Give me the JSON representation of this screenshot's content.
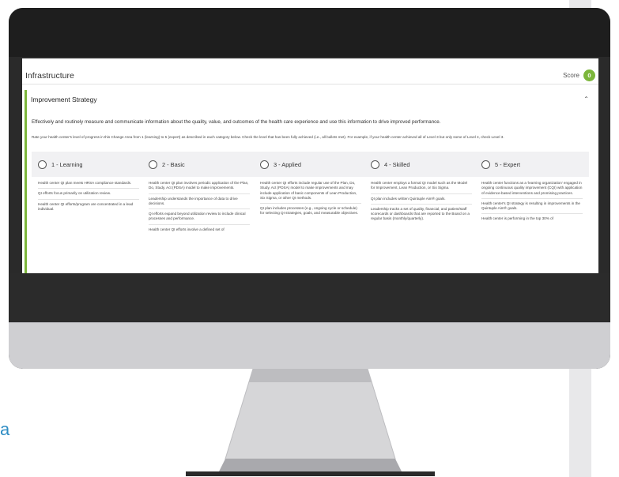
{
  "edge_text": "a",
  "screen": {
    "section_title": "Infrastructure",
    "score_label": "Score",
    "score_value": "0",
    "panel_title": "Improvement Strategy",
    "description": "Effectively and routinely measure and communicate information about the quality, value, and outcomes of the health care experience and use this information to drive improved performance.",
    "rate_text": "Rate your health center's level of progress in this Change Area from 1 (learning) to 5 (expert) as described in each category below. Check the level that has been fully achieved (i.e., all bullets met). For example, if your health center achieved all of Level 3 but only some of Level 4, check Level 3.",
    "levels": [
      {
        "label": "1 - Learning",
        "criteria": [
          "Health center QI plan meets HRSA compliance standards.",
          "QI efforts focus primarily on utilization review.",
          "Health center QI efforts/program are concentrated in a lead individual."
        ]
      },
      {
        "label": "2 - Basic",
        "criteria": [
          "Health center QI plan involves periodic application of the Plan, Do, Study, Act (PDSA) model to make improvements.",
          "Leadership understands the importance of data to drive decisions.",
          "QI efforts expand beyond utilization review to include clinical processes and performance.",
          "Health center QI efforts involve a defined set of"
        ]
      },
      {
        "label": "3 - Applied",
        "criteria": [
          "Health center QI efforts include regular use of the Plan, Do, Study, Act (PDSA) model to make improvements and may include application of basic components of Lean Production, Six Sigma, or other QI methods.",
          "QI plan includes processes (e.g., ongoing cycle or schedule) for selecting QI strategies, goals, and measurable objectives."
        ]
      },
      {
        "label": "4 - Skilled",
        "criteria": [
          "Health center employs a formal QI model such as the Model for Improvement, Lean Production, or Six Sigma.",
          "QI plan includes written Quintuple Aim® goals.",
          "Leadership tracks a set of quality, financial, and patient/staff scorecards or dashboards that are reported to the Board on a regular basis (monthly/quarterly)."
        ]
      },
      {
        "label": "5 - Expert",
        "criteria": [
          "Health center functions as a 'learning organization' engaged in ongoing continuous quality improvement (CQI) with application of evidence-based interventions and promising practices.",
          "Health center's QI strategy is resulting in improvements in the Quintuple Aim® goals.",
          "Health center is performing in the top 30% of"
        ]
      }
    ]
  },
  "colors": {
    "accent": "#7cb63b",
    "bezel": "#1e1e1e",
    "chin": "#cfcfd2",
    "stand": "#d4d4d6",
    "edge_text": "#2f8dc4"
  }
}
